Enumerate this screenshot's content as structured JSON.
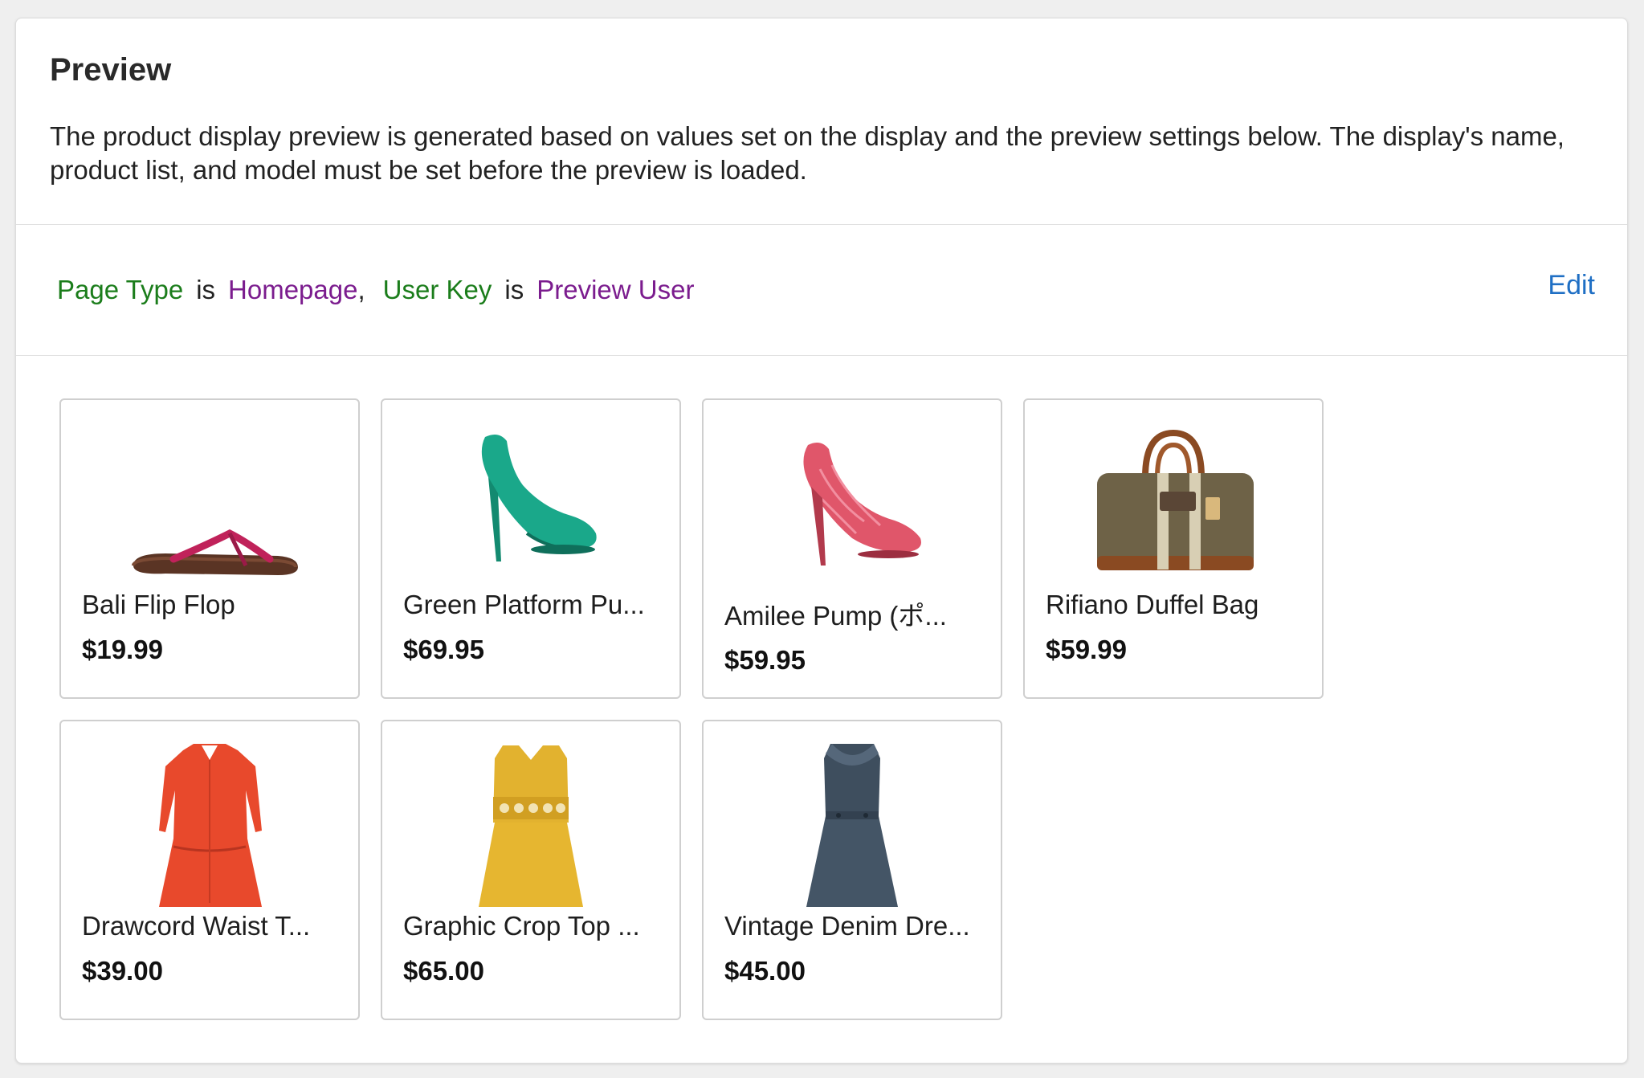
{
  "panel": {
    "title": "Preview",
    "description": "The product display preview is generated based on values set on the display and the preview settings below. The display's name, product list, and model must be set before the preview is loaded."
  },
  "filters": {
    "page_type_key": "Page Type",
    "is_1": "is",
    "page_type_value": "Homepage",
    "comma": ",",
    "user_key_key": "User Key",
    "is_2": "is",
    "user_key_value": "Preview User",
    "edit_label": "Edit"
  },
  "products": [
    {
      "name": "Bali Flip Flop",
      "price": "$19.99",
      "icon": "flip-flop-icon"
    },
    {
      "name": "Green Platform Pu...",
      "price": "$69.95",
      "icon": "green-pump-icon"
    },
    {
      "name": "Amilee Pump (ポ...",
      "price": "$59.95",
      "icon": "pink-pump-icon"
    },
    {
      "name": "Rifiano Duffel Bag",
      "price": "$59.99",
      "icon": "duffel-bag-icon"
    },
    {
      "name": "Drawcord Waist T...",
      "price": "$39.00",
      "icon": "red-dress-icon"
    },
    {
      "name": "Graphic Crop Top ...",
      "price": "$65.00",
      "icon": "yellow-dress-icon"
    },
    {
      "name": "Vintage Denim Dre...",
      "price": "$45.00",
      "icon": "denim-dress-icon"
    }
  ],
  "colors": {
    "key": "#1b7d1b",
    "value": "#7b1c8e",
    "link": "#1f6fc4"
  }
}
